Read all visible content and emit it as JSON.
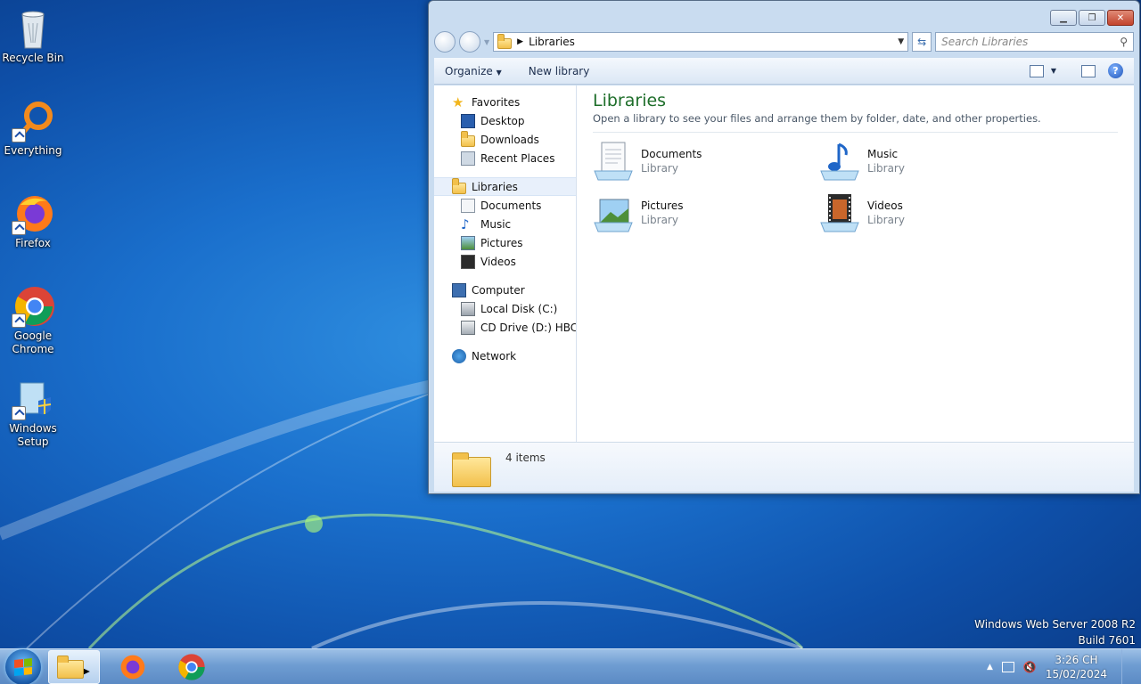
{
  "desktop": {
    "icons": [
      {
        "label": "Recycle Bin",
        "icon": "recycle-bin-icon"
      },
      {
        "label": "Everything",
        "icon": "everything-icon"
      },
      {
        "label": "Firefox",
        "icon": "firefox-icon"
      },
      {
        "label": "Google Chrome",
        "icon": "chrome-icon"
      },
      {
        "label": "Windows Setup",
        "icon": "windows-setup-icon"
      }
    ],
    "watermark": {
      "line1": "Windows Web Server 2008 R2",
      "line2": "Build 7601"
    }
  },
  "explorer": {
    "address": {
      "path": "Libraries"
    },
    "search": {
      "placeholder": "Search Libraries"
    },
    "toolbar": {
      "organize": "Organize",
      "new_library": "New library"
    },
    "nav": {
      "favorites": {
        "label": "Favorites",
        "items": [
          "Desktop",
          "Downloads",
          "Recent Places"
        ]
      },
      "libraries": {
        "label": "Libraries",
        "items": [
          "Documents",
          "Music",
          "Pictures",
          "Videos"
        ]
      },
      "computer": {
        "label": "Computer",
        "items": [
          "Local Disk (C:)",
          "CD Drive (D:) HBCD_"
        ]
      },
      "network": {
        "label": "Network"
      }
    },
    "content": {
      "title": "Libraries",
      "description": "Open a library to see your files and arrange them by folder, date, and other properties.",
      "items": [
        {
          "name": "Documents",
          "type": "Library"
        },
        {
          "name": "Music",
          "type": "Library"
        },
        {
          "name": "Pictures",
          "type": "Library"
        },
        {
          "name": "Videos",
          "type": "Library"
        }
      ]
    },
    "details": {
      "count": "4 items"
    }
  },
  "taskbar": {
    "clock": {
      "time": "3:26 CH",
      "date": "15/02/2024"
    }
  },
  "colors": {
    "title_green": "#1e6e2a",
    "accent_blue": "#1a6fcc"
  }
}
